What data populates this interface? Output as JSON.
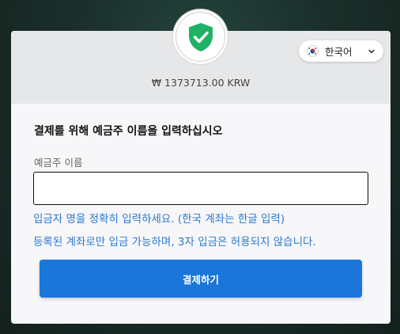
{
  "header": {
    "amount": "₩ 1373713.00 KRW"
  },
  "language": {
    "label": "한국어",
    "flag": "south-korea-flag"
  },
  "form": {
    "title": "결제를 위해 예금주 이름을 입력하십시오",
    "field_label": "예금주 이름",
    "input_value": "",
    "hint_1": "입금자 명을 정확히 입력하세요. (한국 계좌는 한글 입력)",
    "hint_2": "등록된 계좌로만 입금 가능하며, 3자 입금은 허용되지 않습니다.",
    "submit_label": "결제하기"
  },
  "colors": {
    "accent": "#1a76d8",
    "hint_text": "#2c78cf",
    "shield": "#1fb265"
  },
  "icons": {
    "security": "shield-check-icon",
    "dropdown": "chevron-down-icon"
  }
}
